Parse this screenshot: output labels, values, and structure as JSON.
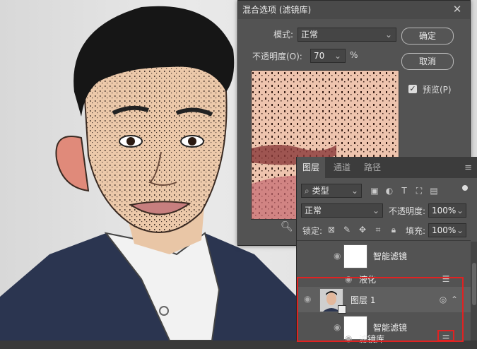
{
  "dialog": {
    "title": "混合选项 (滤镜库)",
    "mode_label": "模式:",
    "mode_value": "正常",
    "opacity_label": "不透明度(O):",
    "opacity_value": "70",
    "opacity_unit": "%",
    "ok_label": "确定",
    "cancel_label": "取消",
    "preview_label": "预览(P)",
    "preview_checked": true
  },
  "layers_panel": {
    "tabs": [
      "图层",
      "通道",
      "路径"
    ],
    "active_tab": "图层",
    "filter_kind": "类型",
    "blend_mode": "正常",
    "opacity_label": "不透明度:",
    "opacity_value": "100%",
    "lock_label": "锁定:",
    "fill_label": "填充:",
    "fill_value": "100%",
    "rows": [
      {
        "type": "smart-filter",
        "label": "智能滤镜"
      },
      {
        "type": "filter",
        "label": "液化"
      },
      {
        "type": "layer",
        "label": "图层 1"
      },
      {
        "type": "smart-filter",
        "label": "智能滤镜"
      },
      {
        "type": "filter",
        "label": "滤镜库"
      }
    ]
  },
  "colors": {
    "panel_bg": "#535353",
    "highlight": "#e02222"
  }
}
